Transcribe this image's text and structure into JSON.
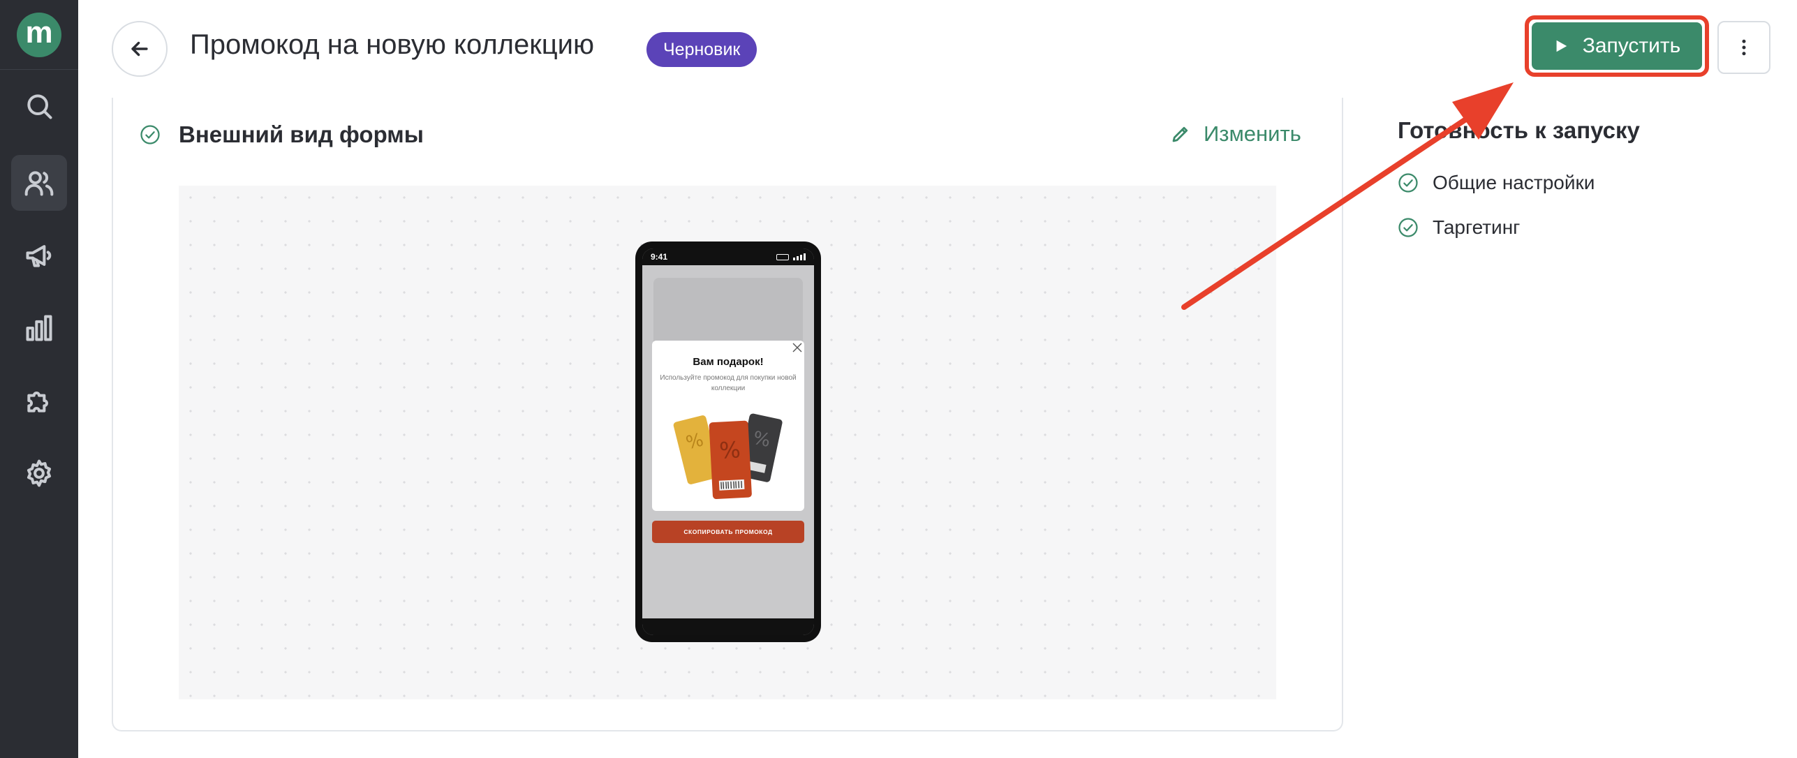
{
  "app": {
    "logo_letter": "m"
  },
  "sidebar": {
    "items": [
      {
        "icon": "search-icon"
      },
      {
        "icon": "users-icon",
        "active": true
      },
      {
        "icon": "megaphone-icon"
      },
      {
        "icon": "bar-chart-icon"
      },
      {
        "icon": "puzzle-icon"
      },
      {
        "icon": "gear-icon"
      }
    ]
  },
  "header": {
    "title": "Промокод на новую коллекцию",
    "status": "Черновик",
    "launch_label": "Запустить"
  },
  "form_section": {
    "title": "Внешний вид формы",
    "edit_label": "Изменить"
  },
  "phone_preview": {
    "time": "9:41",
    "popup_title": "Вам подарок!",
    "popup_text": "Используйте промокод для покупки новой коллекции",
    "cta_label": "СКОПИРОВАТЬ ПРОМОКОД"
  },
  "readiness": {
    "title": "Готовность к запуску",
    "items": [
      {
        "label": "Общие настройки"
      },
      {
        "label": "Таргетинг"
      }
    ]
  },
  "colors": {
    "accent": "#3b8a6a",
    "badge": "#5b43b8",
    "highlight": "#e8402b",
    "sidebar": "#2b2d33"
  }
}
